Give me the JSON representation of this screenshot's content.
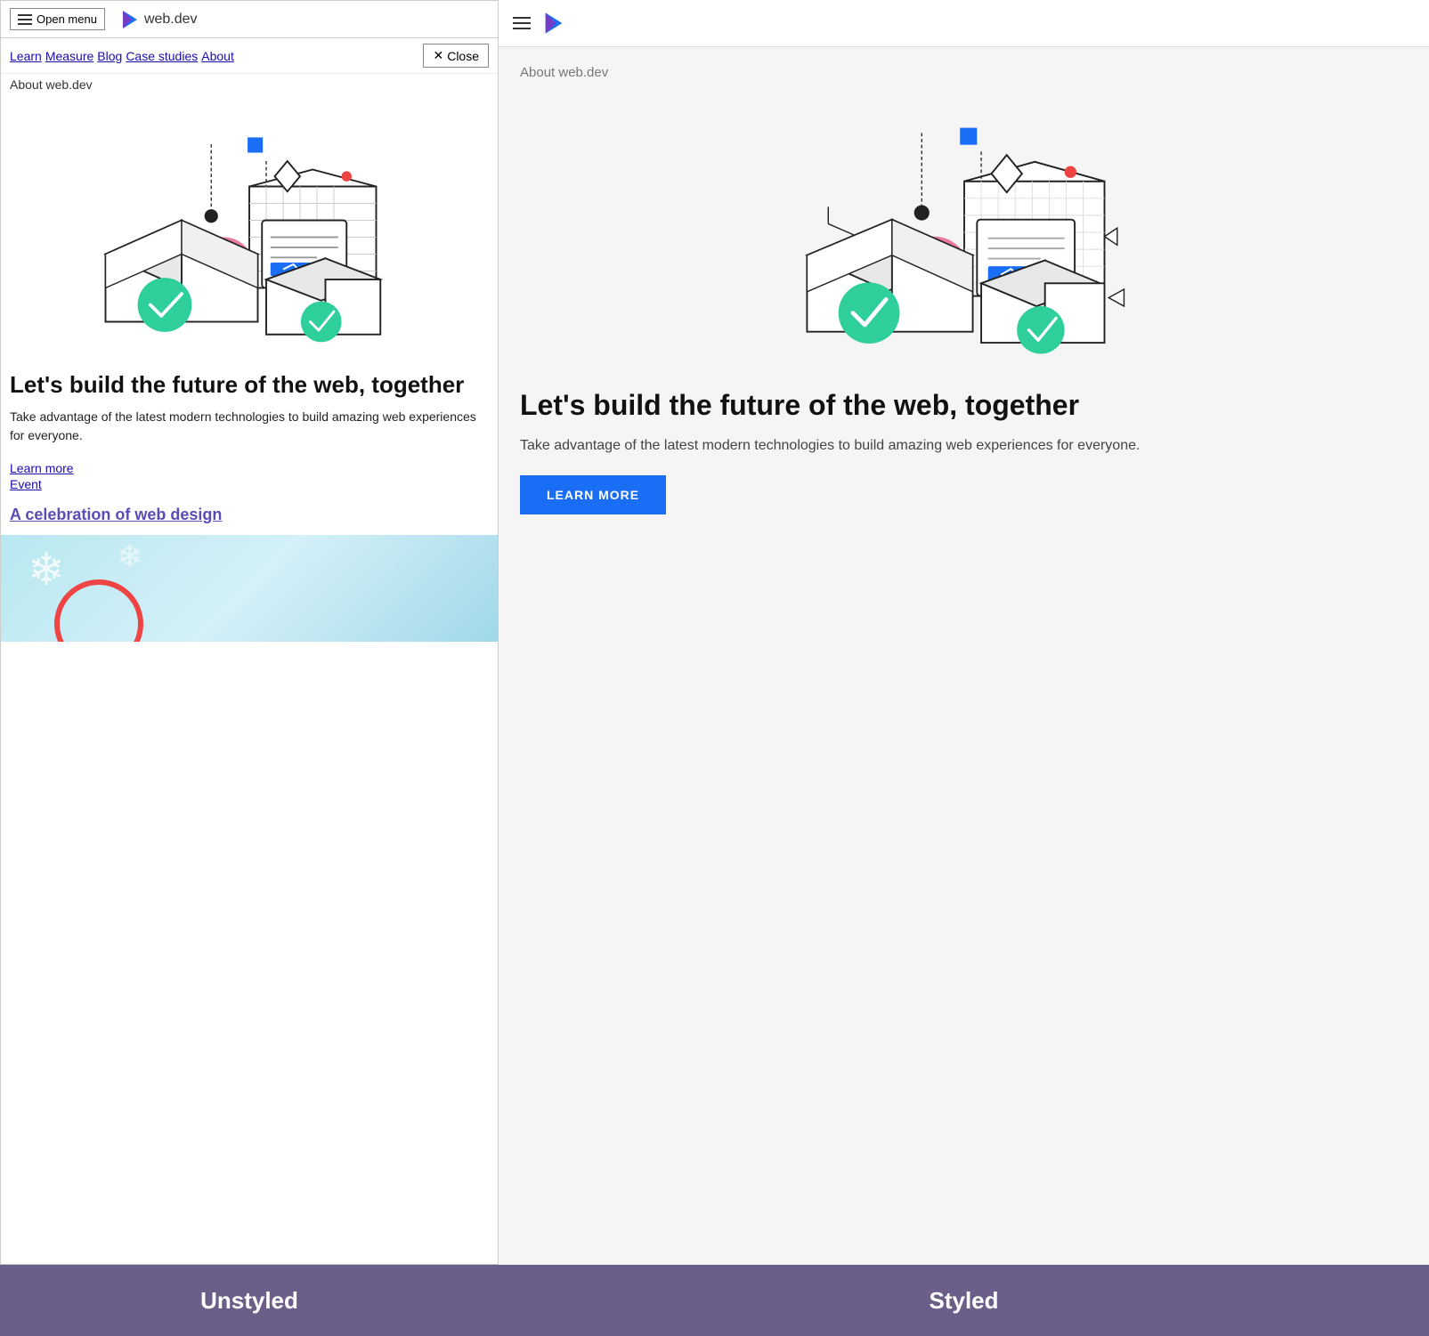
{
  "left": {
    "header": {
      "menu_label": "Open menu",
      "site_name": "web.dev",
      "close_label": "Close"
    },
    "nav": {
      "items": [
        "Learn",
        "Measure",
        "Blog",
        "Case studies",
        "About"
      ]
    },
    "about_label": "About web.dev",
    "hero": {
      "title": "Let's build the future of the web, together",
      "description": "Take advantage of the latest modern technologies to build amazing web experiences for everyone.",
      "learn_more": "Learn more",
      "event": "Event",
      "celebration_link": "A celebration of web design"
    }
  },
  "right": {
    "about_label": "About web.dev",
    "hero": {
      "title": "Let's build the future of the web, together",
      "description": "Take advantage of the latest modern technologies to build amazing web experiences for everyone.",
      "button_label": "LEARN MORE"
    }
  },
  "bottom": {
    "unstyled_label": "Unstyled",
    "styled_label": "Styled"
  },
  "icons": {
    "hamburger": "≡",
    "close": "✕",
    "logo": "▶"
  }
}
